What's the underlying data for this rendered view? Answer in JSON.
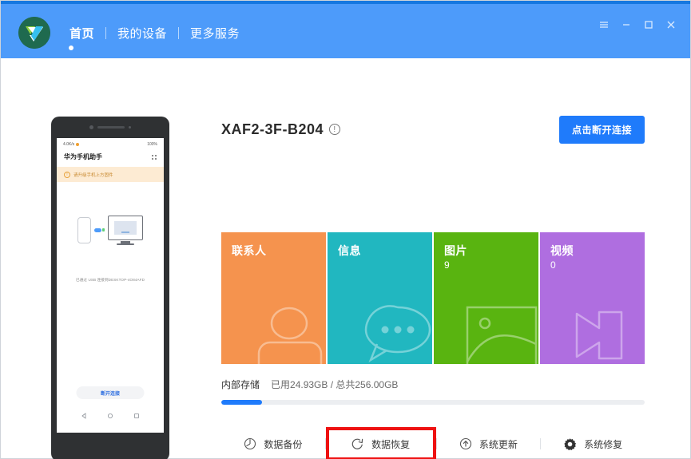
{
  "window": {
    "controls": [
      {
        "name": "menu-button",
        "glyph": "menu"
      },
      {
        "name": "minimize-button",
        "glyph": "minimize"
      },
      {
        "name": "maximize-button",
        "glyph": "maximize"
      },
      {
        "name": "close-button",
        "glyph": "close"
      }
    ]
  },
  "header": {
    "nav": [
      {
        "label": "首页",
        "active": true
      },
      {
        "label": "我的设备",
        "active": false
      },
      {
        "label": "更多服务",
        "active": false
      }
    ],
    "brand_color": "#4D9BFA",
    "accent_color": "#1678E0"
  },
  "phone": {
    "app_title": "华为手机助手",
    "status_left": "4.0K/s",
    "status_right": "100%",
    "warning": "请升级手机上方固件",
    "connection_text": "已通过 USB 连接到DESKTOP-4O84AFD",
    "disconnect_label": "断开连接"
  },
  "device": {
    "name": "XAF2-3F-B204",
    "info_icon": "info-icon",
    "reconnect_label": "点击断开连接",
    "reconnect_color": "#1F7BFB"
  },
  "tiles": [
    {
      "label": "联系人",
      "count": "",
      "color": "#F5934E",
      "icon": "contact-icon"
    },
    {
      "label": "信息",
      "count": "",
      "color": "#21B7C0",
      "icon": "message-icon"
    },
    {
      "label": "图片",
      "count": "9",
      "color": "#59B410",
      "icon": "picture-icon"
    },
    {
      "label": "视频",
      "count": "0",
      "color": "#AF6EE0",
      "icon": "video-icon"
    }
  ],
  "storage": {
    "label": "内部存储",
    "usage": "已用24.93GB / 总共256.00GB",
    "used_gb": 24.93,
    "total_gb": 256.0,
    "percent": 9.7,
    "fill_color": "#1F7BFB"
  },
  "actions": [
    {
      "label": "数据备份",
      "icon": "backup-clock-icon",
      "highlighted": false
    },
    {
      "label": "数据恢复",
      "icon": "restore-arc-icon",
      "highlighted": true
    },
    {
      "label": "系统更新",
      "icon": "update-arrow-icon",
      "highlighted": false
    },
    {
      "label": "系统修复",
      "icon": "gear-icon",
      "highlighted": false
    }
  ],
  "highlight_color": "#EE1111"
}
